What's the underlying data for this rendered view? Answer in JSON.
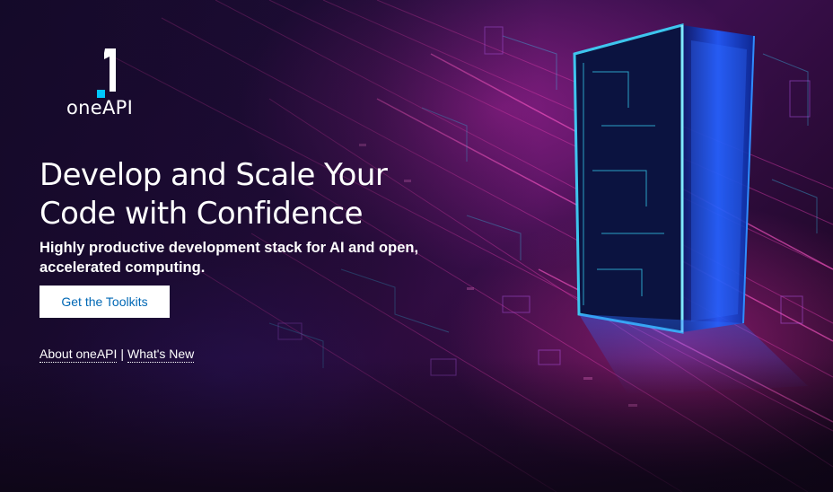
{
  "brand": {
    "logo_digit": "1",
    "logo_text": "oneAPI"
  },
  "hero": {
    "headline": "Develop and Scale Your Code with Confidence",
    "subheadline": "Highly productive development stack for AI and open, accelerated computing.",
    "cta_label": "Get the Toolkits"
  },
  "links": {
    "about": "About oneAPI",
    "separator": "|",
    "whats_new": "What's New"
  },
  "colors": {
    "cta_text": "#0068b5",
    "cta_background": "#ffffff",
    "logo_accent": "#00c7fd",
    "portal_glow": "#2f8cff",
    "magenta_glow": "#e0399f"
  },
  "background": {
    "description_icon": "circuit-board-portal-illustration"
  }
}
